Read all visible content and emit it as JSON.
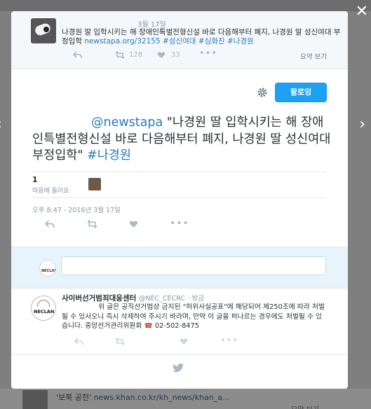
{
  "background": {
    "post_preview_text": "'보복 공천'",
    "post_preview_link": "news.khan.co.kr/kh_news/khan_a...",
    "post_preview_more": "요약 보기"
  },
  "controls": {
    "close_glyph": "✕",
    "prev_glyph": "‹",
    "next_glyph": "›"
  },
  "parent_tweet": {
    "date": "3월 17일",
    "text": "나경원 딸 입학시키는 해 장애인특별전형신설 바로 다음해부터 폐지, 나경원 딸 성신여대 부정입학",
    "link": "newstapa.org/32155",
    "hashtags": [
      "#성신여대",
      "#심화진",
      "#나경원"
    ],
    "retweets": "128",
    "likes": "33",
    "view_summary": "요약 보기"
  },
  "main_tweet": {
    "follow_label": "팔로잉",
    "mention": "@newstapa",
    "text": "\"나경원 딸 입학시키는 해 장애인특별전형신설 바로 다음해부터 폐지, 나경원 딸 성신여대 부정입학\"",
    "hashtag": "#나경원",
    "like_count": "1",
    "like_label": "마음에 들어요",
    "timestamp": "오후 8:47 - 2016년 3월 17일"
  },
  "reply_box": {
    "placeholder": ""
  },
  "reply_tweet": {
    "name": "사이버선거범죄대응센터",
    "handle": "@NEC_CECRC",
    "time": "· 방금",
    "body": "위 글은 공직선거법상 금지된 \"허위사실공표\"에 해당되어 제250조에 따라 처벌될 수 있사오니 즉시 삭제하여 주시기 바라며, 만약 이 글을 퍼나르는 경우에도 처벌될 수 있습니다. 중앙선거관리위원회",
    "phone_icon": "☎",
    "phone": "02-502-8475",
    "avatar_text": "NECLAN"
  },
  "colors": {
    "accent": "#1da1f2",
    "link": "#2b7bb9",
    "muted": "#8899a6"
  }
}
